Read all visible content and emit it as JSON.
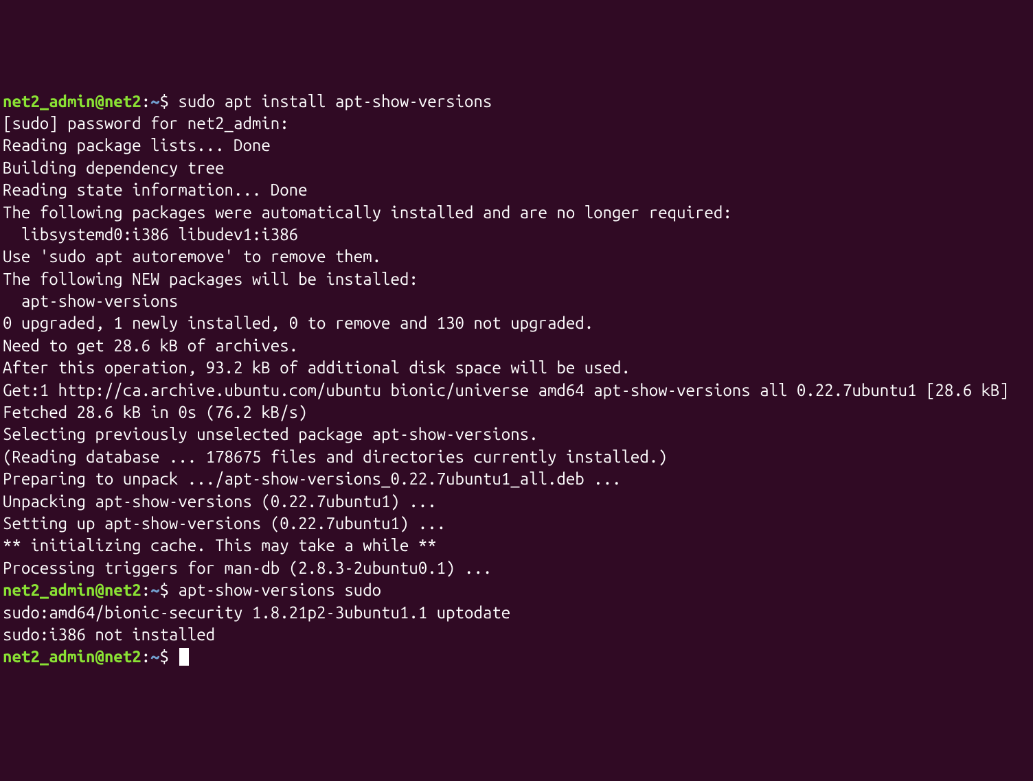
{
  "prompt1": {
    "user_host": "net2_admin@net2",
    "colon": ":",
    "path": "~",
    "dollar": "$ ",
    "command": "sudo apt install apt-show-versions"
  },
  "output1": [
    "[sudo] password for net2_admin:",
    "Reading package lists... Done",
    "Building dependency tree",
    "Reading state information... Done",
    "The following packages were automatically installed and are no longer required:",
    "  libsystemd0:i386 libudev1:i386",
    "Use 'sudo apt autoremove' to remove them.",
    "The following NEW packages will be installed:",
    "  apt-show-versions",
    "0 upgraded, 1 newly installed, 0 to remove and 130 not upgraded.",
    "Need to get 28.6 kB of archives.",
    "After this operation, 93.2 kB of additional disk space will be used.",
    "Get:1 http://ca.archive.ubuntu.com/ubuntu bionic/universe amd64 apt-show-versions all 0.22.7ubuntu1 [28.6 kB]",
    "Fetched 28.6 kB in 0s (76.2 kB/s)",
    "Selecting previously unselected package apt-show-versions.",
    "(Reading database ... 178675 files and directories currently installed.)",
    "Preparing to unpack .../apt-show-versions_0.22.7ubuntu1_all.deb ...",
    "Unpacking apt-show-versions (0.22.7ubuntu1) ...",
    "Setting up apt-show-versions (0.22.7ubuntu1) ...",
    "** initializing cache. This may take a while **",
    "Processing triggers for man-db (2.8.3-2ubuntu0.1) ..."
  ],
  "prompt2": {
    "user_host": "net2_admin@net2",
    "colon": ":",
    "path": "~",
    "dollar": "$ ",
    "command": "apt-show-versions sudo"
  },
  "output2": [
    "sudo:amd64/bionic-security 1.8.21p2-3ubuntu1.1 uptodate",
    "sudo:i386 not installed"
  ],
  "prompt3": {
    "user_host": "net2_admin@net2",
    "colon": ":",
    "path": "~",
    "dollar": "$ "
  }
}
